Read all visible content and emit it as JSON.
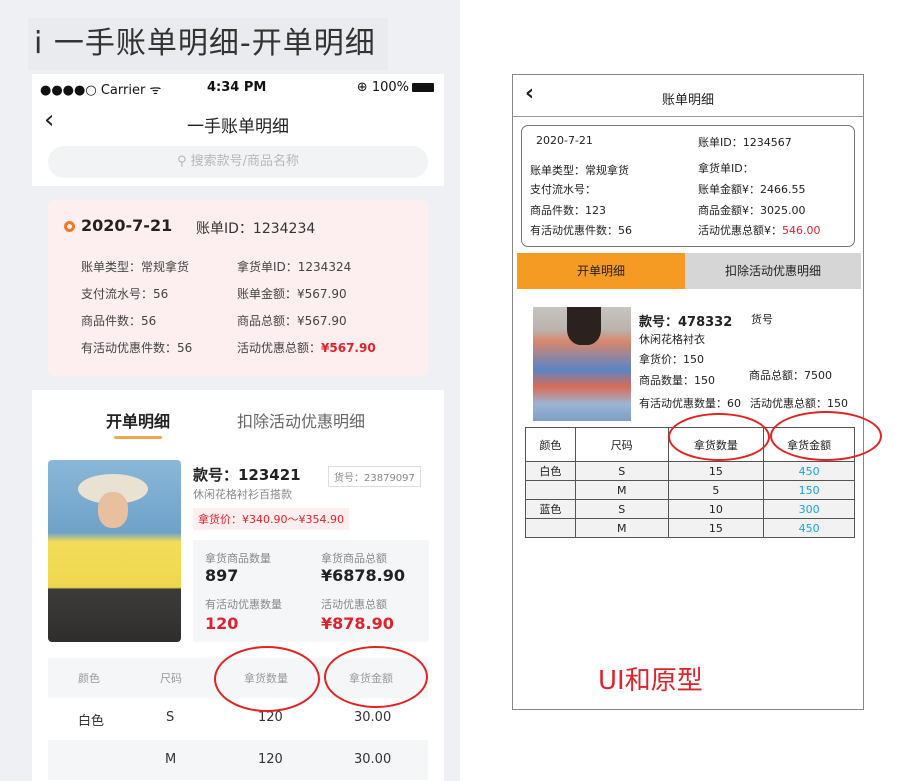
{
  "heading": "i 一手账单明细-开单明细",
  "mock": {
    "status": {
      "carrier": "●●●●○ Carrier ᯤ",
      "time": "4:34 PM",
      "battery": "⊕ 100%"
    },
    "nav_title": "一手账单明细",
    "search_placeholder": "搜索款号/商品名称",
    "bill": {
      "date": "2020-7-21",
      "bill_id": "账单ID：1234234",
      "left": [
        "账单类型：常规拿货",
        "支付流水号：56",
        "商品件数：56",
        "有活动优惠件数：56"
      ],
      "right": [
        "拿货单ID：1234324",
        "账单金额：¥567.90",
        "商品总额：¥567.90"
      ],
      "promo_label": "活动优惠总额：",
      "promo_value": "¥567.90"
    },
    "tabs": [
      "开单明细",
      "扣除活动优惠明细"
    ],
    "product": {
      "code": "款号：123421",
      "sku": "货号：23879097",
      "desc": "休闲花格衬衫百搭款",
      "price": "拿货价：¥340.90～¥354.90",
      "stats": [
        {
          "label": "拿货商品数量",
          "value": "897"
        },
        {
          "label": "拿货商品总额",
          "value": "¥6878.90"
        },
        {
          "label": "有活动优惠数量",
          "value": "120"
        },
        {
          "label": "活动优惠总额",
          "value": "¥878.90"
        }
      ]
    },
    "table": {
      "headers": [
        "颜色",
        "尺码",
        "拿货数量",
        "拿货金额"
      ],
      "rows": [
        [
          "白色",
          "S",
          "120",
          "30.00"
        ],
        [
          "",
          "M",
          "120",
          "30.00"
        ]
      ]
    }
  },
  "proto": {
    "title": "账单明细",
    "card": {
      "date": "2020-7-21",
      "left": [
        "账单类型：常规拿货",
        "支付流水号：",
        "商品件数：123",
        "有活动优惠件数：56"
      ],
      "right": [
        "账单ID：1234567",
        "拿货单ID：",
        "账单金额¥：2466.55",
        "商品金额¥：3025.00"
      ],
      "promo_label": "活动优惠总额¥：",
      "promo_value": "546.00"
    },
    "tabs": [
      "开单明细",
      "扣除活动优惠明细"
    ],
    "product": {
      "code": "款号：478332",
      "sku": "货号",
      "desc": "休闲花格衬衣",
      "price": "拿货价：150",
      "qty": "商品数量：150",
      "total": "商品总额：7500",
      "promo_qty": "有活动优惠数量：60",
      "promo_total": "活动优惠总额：150"
    },
    "table": {
      "headers": [
        "颜色",
        "尺码",
        "拿货数量",
        "拿货金额"
      ],
      "rows": [
        [
          "白色",
          "S",
          "15",
          "450"
        ],
        [
          "",
          "M",
          "5",
          "150"
        ],
        [
          "蓝色",
          "S",
          "10",
          "300"
        ],
        [
          "",
          "M",
          "15",
          "450"
        ]
      ]
    }
  },
  "caption": "UI和原型",
  "colors": {
    "accent_orange": "#f59b23",
    "red": "#e0222c",
    "blue": "#1aa3e6"
  }
}
